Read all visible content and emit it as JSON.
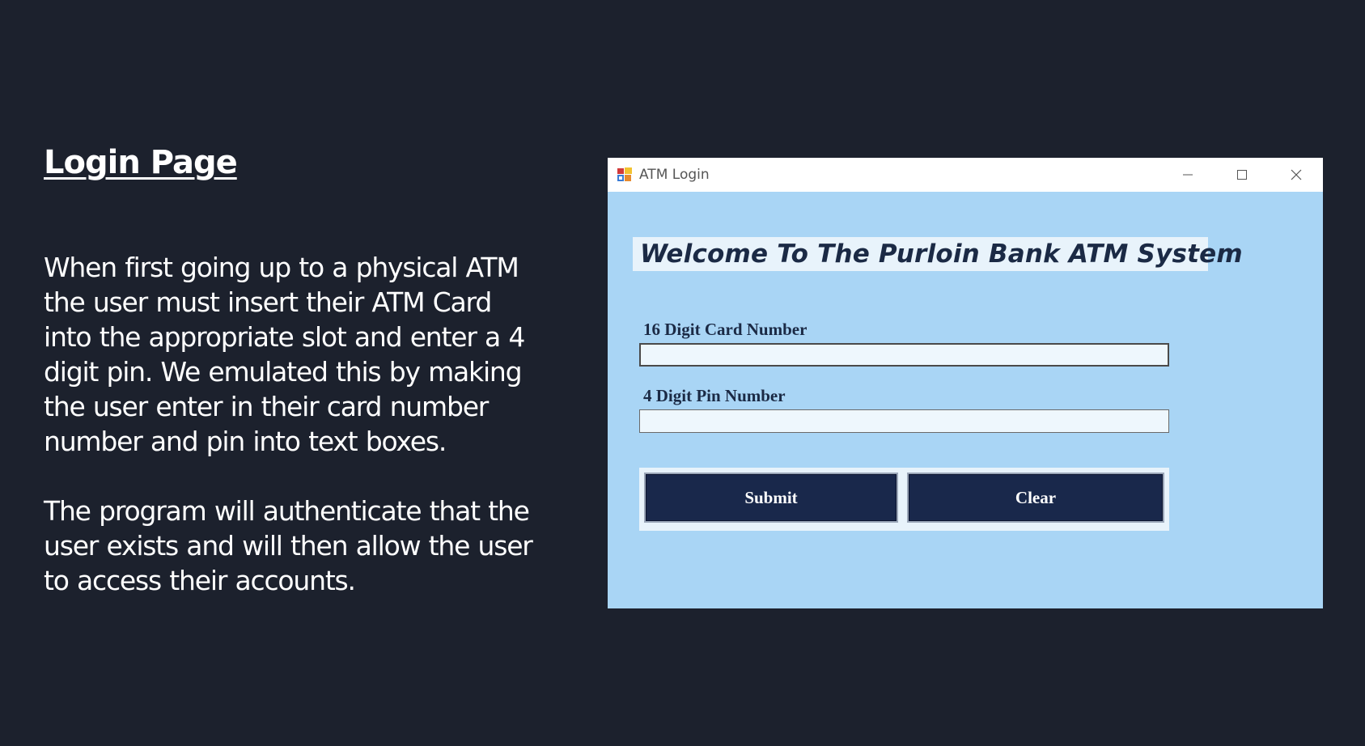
{
  "slide": {
    "title": "Login Page",
    "paragraph1": "When first going up to a physical ATM the user must insert their ATM Card into the appropriate slot  and enter a 4 digit pin. We emulated this by making the user enter in their card number number and pin into text boxes.",
    "paragraph2": "The program will authenticate that the user exists and will then allow the user to access their accounts."
  },
  "window": {
    "title": "ATM Login",
    "icon": "app-icon",
    "controls": {
      "minimize": "minimize-icon",
      "maximize": "maximize-icon",
      "close": "close-icon"
    }
  },
  "form": {
    "welcome": "Welcome To The Purloin Bank ATM System",
    "card_label": "16 Digit Card Number",
    "card_value": "",
    "pin_label": "4 Digit Pin Number",
    "pin_value": "",
    "submit_label": "Submit",
    "clear_label": "Clear"
  },
  "colors": {
    "background": "#1c212d",
    "form_background": "#a9d5f5",
    "button": "#19284b",
    "text_dark": "#1b2a45"
  }
}
